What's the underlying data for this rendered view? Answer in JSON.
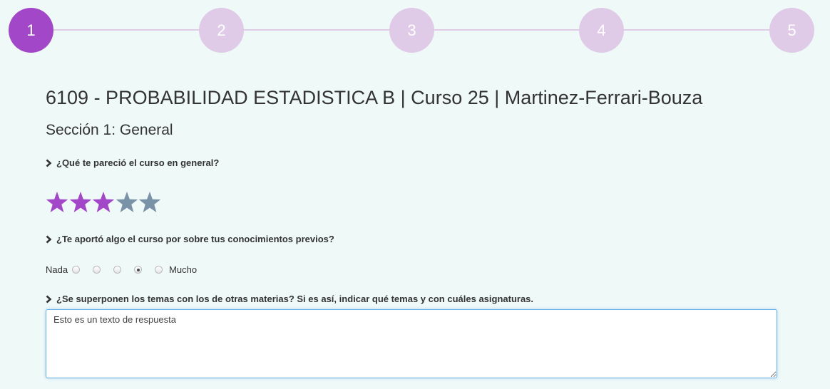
{
  "stepper": {
    "steps": [
      "1",
      "2",
      "3",
      "4",
      "5"
    ],
    "active_step": "1",
    "active_color": "#a347c9",
    "inactive_color": "#dfcbe7"
  },
  "header": {
    "course_title": "6109 - PROBABILIDAD ESTADISTICA B | Curso 25 | Martinez-Ferrari-Bouza",
    "section_title": "Sección 1: General"
  },
  "questions": [
    {
      "label": "¿Qué te pareció el curso en general?",
      "type": "stars",
      "rating": 3,
      "max": 5,
      "filled_color": "#a347c9",
      "empty_color": "#7992a8"
    },
    {
      "label": "¿Te aportó algo el curso por sobre tus conocimientos previos?",
      "type": "scale",
      "min_label": "Nada",
      "max_label": "Mucho",
      "options": 5,
      "selected": 4
    },
    {
      "label": "¿Se superponen los temas con los de otras materias? Si es así, indicar qué temas y con cuáles asignaturas.",
      "type": "text",
      "value": "Esto es un texto de respuesta"
    }
  ]
}
